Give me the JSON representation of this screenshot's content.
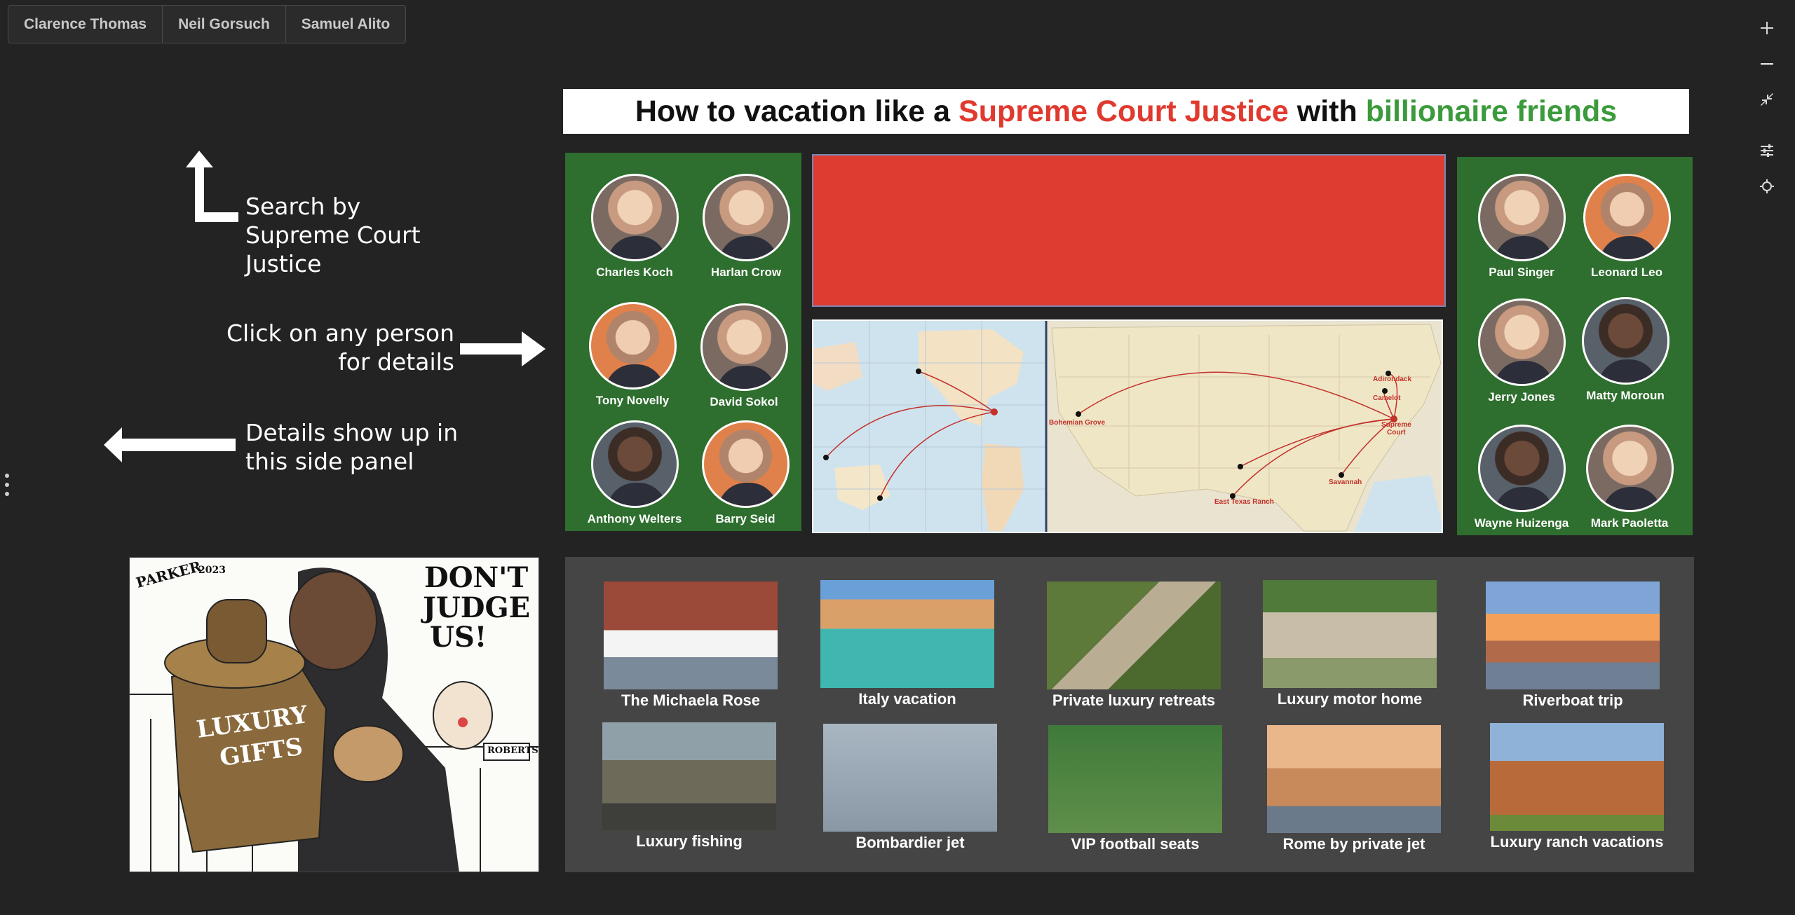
{
  "tabs": [
    "Clarence Thomas",
    "Neil Gorsuch",
    "Samuel Alito"
  ],
  "toolbar": {
    "icons": [
      "zoom-in-icon",
      "zoom-out-icon",
      "collapse-icon",
      "settings-sliders-icon",
      "locate-icon"
    ]
  },
  "instructions": {
    "search": "Search by Supreme Court Justice",
    "click": "Click on any person for details",
    "details": "Details show up in this side panel"
  },
  "title": {
    "part1": "How to vacation like a",
    "part2": "Supreme Court Justice",
    "part3": "with",
    "part4": "billionaire friends",
    "colors": {
      "red": "#e03a2f",
      "green": "#3b9b3c"
    }
  },
  "people_left": [
    {
      "name": "Charles Koch"
    },
    {
      "name": "Harlan Crow"
    },
    {
      "name": "Tony Novelly"
    },
    {
      "name": "David Sokol"
    },
    {
      "name": "Anthony Welters"
    },
    {
      "name": "Barry Seid"
    }
  ],
  "people_right": [
    {
      "name": "Paul Singer"
    },
    {
      "name": "Leonard Leo"
    },
    {
      "name": "Jerry Jones"
    },
    {
      "name": "Matty Moroun"
    },
    {
      "name": "Wayne Huizenga"
    },
    {
      "name": "Mark Paoletta"
    }
  ],
  "map": {
    "labels": {
      "bohemian": "Bohemian Grove",
      "adirondack": "Adirondack",
      "camelot": "Camelot",
      "supreme": "Supreme",
      "court": "Court",
      "savannah": "Savannah",
      "texas": "East Texas Ranch"
    }
  },
  "cartoon": {
    "speech1": "DON'T",
    "speech2": "JUDGE",
    "speech3": "US!",
    "mug1": "LUXURY",
    "mug2": "GIFTS",
    "plate": "ROBERTS",
    "signature": "PARKER",
    "year": "2023"
  },
  "activities": [
    {
      "label": "The Michaela Rose"
    },
    {
      "label": "Italy vacation"
    },
    {
      "label": "Private luxury retreats"
    },
    {
      "label": "Luxury motor home"
    },
    {
      "label": "Riverboat trip"
    },
    {
      "label": "Luxury fishing"
    },
    {
      "label": "Bombardier jet"
    },
    {
      "label": "VIP football seats"
    },
    {
      "label": "Rome by private jet"
    },
    {
      "label": "Luxury ranch vacations"
    }
  ]
}
